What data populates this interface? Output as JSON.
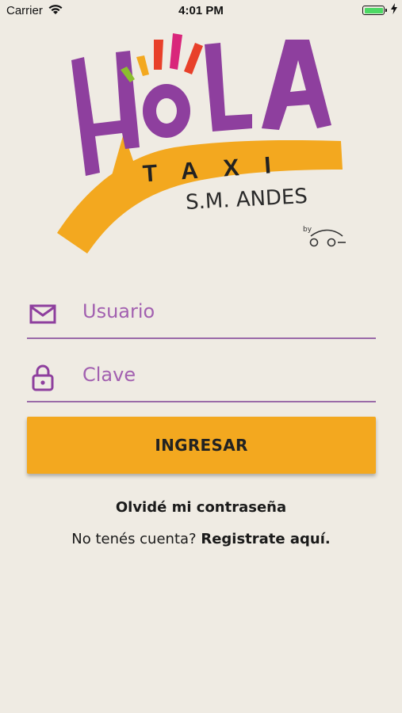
{
  "status_bar": {
    "carrier": "Carrier",
    "time": "4:01 PM",
    "battery_level": 1.0,
    "battery_color": "#4cd964"
  },
  "logo": {
    "hola_text": "HOLA",
    "taxi_text": "TAXI",
    "subtitle": "S.M. ANDES",
    "by_text": "by"
  },
  "form": {
    "username_placeholder": "Usuario",
    "username_value": "",
    "password_placeholder": "Clave",
    "password_value": "",
    "login_label": "INGRESAR"
  },
  "links": {
    "forgot_password": "Olvidé mi contraseña",
    "no_account": "No tenés cuenta?",
    "register": "Registrate aquí."
  },
  "colors": {
    "background": "#efebe3",
    "purple": "#8e3f9e",
    "orange": "#f3a81f"
  },
  "icons": {
    "username": "envelope-icon",
    "password": "lock-icon"
  }
}
